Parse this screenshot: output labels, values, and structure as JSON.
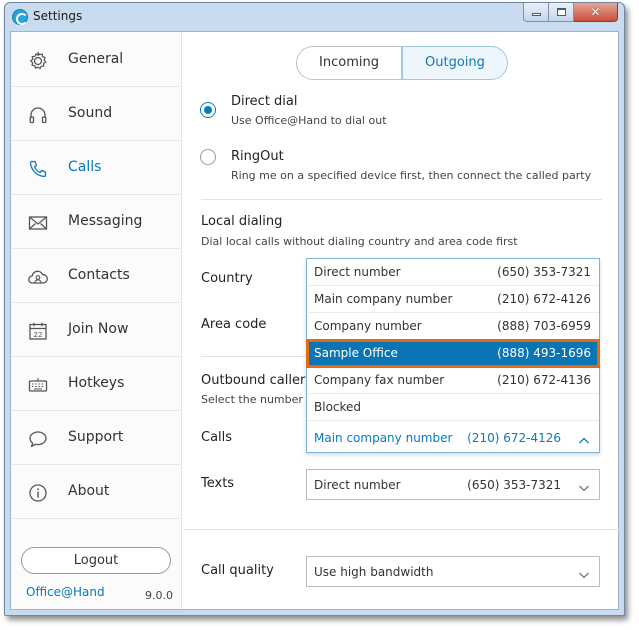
{
  "window": {
    "title": "Settings",
    "icons": {
      "app": "app-logo-icon",
      "minimize": "minimize-icon",
      "maximize": "maximize-icon",
      "close": "close-icon"
    }
  },
  "sidebar": {
    "items": [
      {
        "label": "General",
        "icon": "gear-icon",
        "active": false
      },
      {
        "label": "Sound",
        "icon": "headphones-icon",
        "active": false
      },
      {
        "label": "Calls",
        "icon": "phone-icon",
        "active": true
      },
      {
        "label": "Messaging",
        "icon": "envelope-icon",
        "active": false
      },
      {
        "label": "Contacts",
        "icon": "contacts-cloud-icon",
        "active": false
      },
      {
        "label": "Join Now",
        "icon": "calendar-icon",
        "active": false
      },
      {
        "label": "Hotkeys",
        "icon": "keyboard-icon",
        "active": false
      },
      {
        "label": "Support",
        "icon": "chat-bubble-icon",
        "active": false
      },
      {
        "label": "About",
        "icon": "info-icon",
        "active": false
      }
    ],
    "logout_label": "Logout",
    "brand": "Office@Hand",
    "version": "9.0.0"
  },
  "tabs": {
    "incoming": "Incoming",
    "outgoing": "Outgoing",
    "selected": "Outgoing"
  },
  "dial_options": {
    "direct_dial": {
      "title": "Direct dial",
      "desc": "Use Office@Hand to dial out",
      "checked": true
    },
    "ringout": {
      "title": "RingOut",
      "desc": "Ring me on a specified device first, then connect the called party",
      "checked": false
    }
  },
  "local_dialing": {
    "title": "Local dialing",
    "desc": "Dial local calls without dialing country and area code first",
    "country_label": "Country",
    "area_code_label": "Area code"
  },
  "caller_id": {
    "title": "Outbound caller I",
    "desc": "Select the number yo",
    "calls_label": "Calls",
    "texts_label": "Texts",
    "calls_dropdown": {
      "options": [
        {
          "name": "Direct number",
          "number": "(650) 353-7321"
        },
        {
          "name": "Main company number",
          "number": "(210) 672-4126"
        },
        {
          "name": "Company number",
          "number": "(888) 703-6959"
        },
        {
          "name": "Sample Office",
          "number": "(888) 493-1696",
          "highlighted": true
        },
        {
          "name": "Company fax number",
          "number": "(210) 672-4136"
        },
        {
          "name": "Blocked",
          "number": ""
        }
      ],
      "current": {
        "name": "Main company number",
        "number": "(210) 672-4126"
      },
      "chevron_icon": "chevron-up-icon"
    },
    "texts_select": {
      "name": "Direct number",
      "number": "(650) 353-7321",
      "chevron_icon": "chevron-down-icon"
    }
  },
  "call_quality": {
    "label": "Call quality",
    "value": "Use high bandwidth",
    "chevron_icon": "chevron-down-icon"
  },
  "colors": {
    "accent": "#0a7ab8",
    "highlight_outline": "#e36c12",
    "selected_row": "#0a75b4"
  }
}
